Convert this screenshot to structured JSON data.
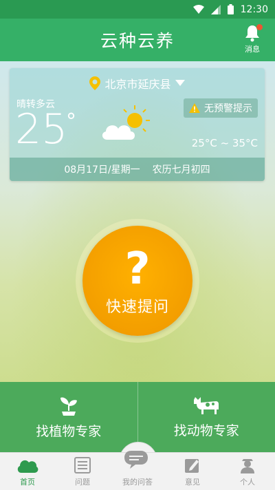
{
  "status_bar": {
    "time": "12:30"
  },
  "app_bar": {
    "title": "云种云养",
    "message_label": "消息"
  },
  "weather": {
    "location": "北京市延庆县",
    "condition": "晴转多云",
    "temperature": "25",
    "degree_symbol": "°",
    "warning": "无预警提示",
    "range": "25°C ~ 35°C",
    "date": "08月17日/星期一",
    "lunar": "农历七月初四"
  },
  "quick_ask": {
    "symbol": "?",
    "label": "快速提问"
  },
  "experts": [
    {
      "label": "找植物专家"
    },
    {
      "label": "找动物专家"
    }
  ],
  "tabs": [
    {
      "label": "首页"
    },
    {
      "label": "问题"
    },
    {
      "label": "我的问答"
    },
    {
      "label": "意见"
    },
    {
      "label": "个人"
    }
  ],
  "colors": {
    "primary": "#35b067",
    "accent": "#f39e00",
    "status_bar": "#2a9a52"
  }
}
